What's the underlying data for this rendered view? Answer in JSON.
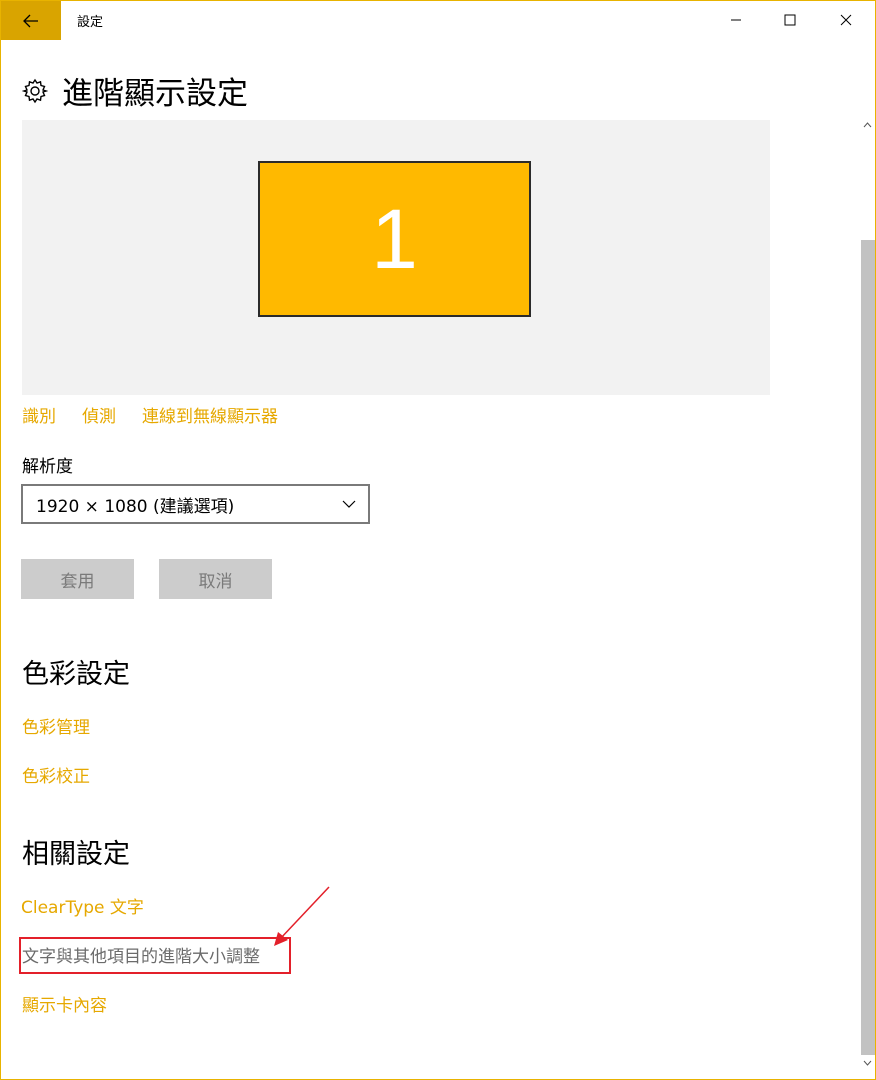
{
  "window": {
    "title": "設定",
    "accent_color": "#ffb900"
  },
  "header": {
    "icon": "gear-icon",
    "title": "進階顯示設定"
  },
  "display": {
    "monitor_number": "1"
  },
  "display_actions": {
    "identify": "識別",
    "detect": "偵測",
    "connect_wireless": "連線到無線顯示器"
  },
  "resolution": {
    "label": "解析度",
    "selected": "1920 × 1080 (建議選項)"
  },
  "buttons": {
    "apply": "套用",
    "cancel": "取消"
  },
  "color_settings": {
    "heading": "色彩設定",
    "color_management": "色彩管理",
    "color_calibration": "色彩校正"
  },
  "related_settings": {
    "heading": "相關設定",
    "cleartype": "ClearType 文字",
    "advanced_sizing": "文字與其他項目的進階大小調整",
    "adapter_properties": "顯示卡內容"
  },
  "colors": {
    "link": "#e6a800",
    "highlight": "#e3202a"
  }
}
